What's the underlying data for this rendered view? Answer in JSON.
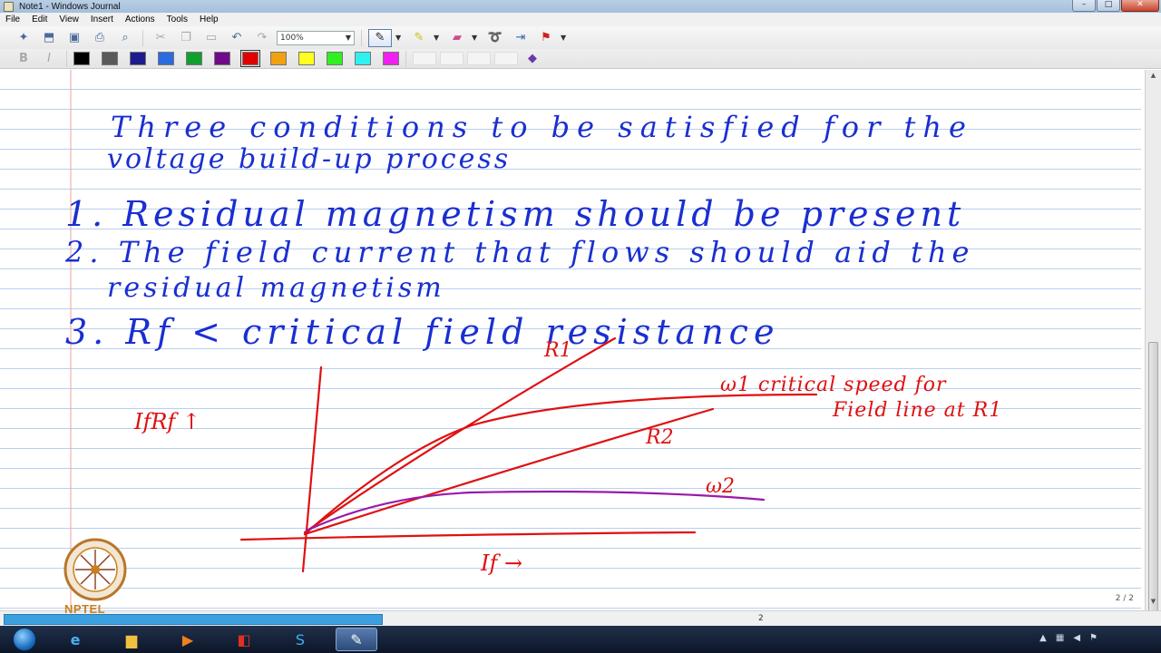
{
  "window": {
    "title": "Note1 - Windows Journal"
  },
  "menu": [
    "File",
    "Edit",
    "View",
    "Insert",
    "Actions",
    "Tools",
    "Help"
  ],
  "toolbar": {
    "zoom": "100%",
    "palette": [
      "#000000",
      "#5a5a5a",
      "#1c1c8c",
      "#2a6be0",
      "#10a030",
      "#700a8a",
      "#e00000",
      "#f0a010",
      "#ffff20",
      "#30f020",
      "#30f0f0",
      "#f020f0"
    ]
  },
  "note": {
    "ink_color": "#1a2fd0",
    "graph_color": "#e01010",
    "curve2_color": "#9a1aa8",
    "lines": {
      "heading_1": "Three conditions to be satisfied for the",
      "heading_2": "voltage build-up process",
      "item_1": "1. Residual magnetism should be present",
      "item_2a": "2. The field current that flows should aid the",
      "item_2b": "residual magnetism",
      "item_3": "3. Rf < critical field resistance"
    },
    "graph_labels": {
      "y_axis": "IfRf ↑",
      "x_axis": "If →",
      "r1": "R1",
      "w1": "ω1 critical speed for",
      "w1b": "Field line at R1",
      "r2": "R2",
      "w2": "ω2"
    }
  },
  "status": {
    "page_indicator": "2 / 2",
    "page_number": "2"
  },
  "logo": {
    "text": "NPTEL"
  }
}
